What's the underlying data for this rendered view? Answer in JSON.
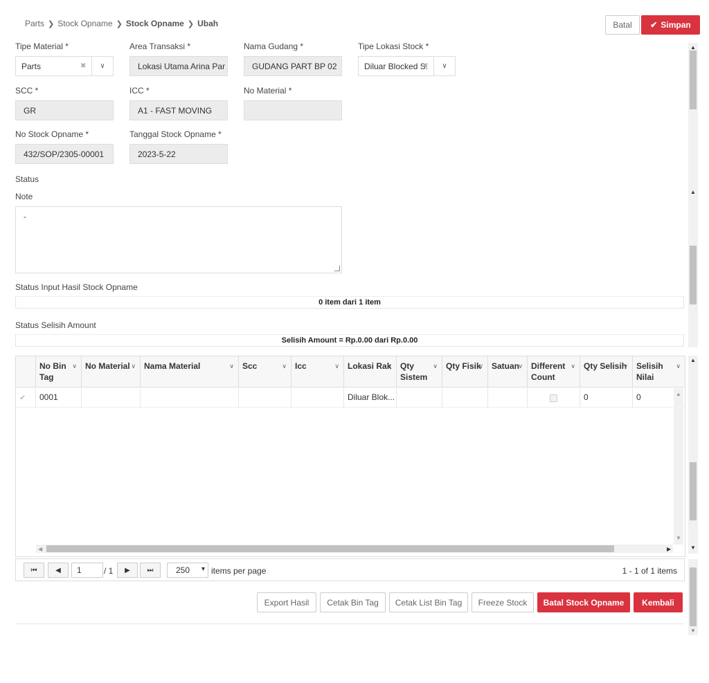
{
  "breadcrumb": {
    "items": [
      "Parts",
      "Stock Opname",
      "Stock Opname",
      "Ubah"
    ]
  },
  "header": {
    "cancel_label": "Batal",
    "save_label": "Simpan"
  },
  "form": {
    "tipe_material": {
      "label": "Tipe Material *",
      "value": "Parts"
    },
    "area_transaksi": {
      "label": "Area Transaksi *",
      "value": "Lokasi Utama Arina Par"
    },
    "nama_gudang": {
      "label": "Nama Gudang *",
      "value": "GUDANG PART BP 02"
    },
    "tipe_lokasi_stock": {
      "label": "Tipe Lokasi Stock *",
      "value": "Diluar Blocked S."
    },
    "scc": {
      "label": "SCC *",
      "value": "GR"
    },
    "icc": {
      "label": "ICC *",
      "value": "A1 - FAST MOVING"
    },
    "no_material": {
      "label": "No Material *",
      "value": ""
    },
    "no_stock_opname": {
      "label": "No Stock Opname *",
      "value": "432/SOP/2305-00001"
    },
    "tanggal_stock_opname": {
      "label": "Tanggal Stock Opname *",
      "value": "2023-5-22"
    },
    "status": {
      "label": "Status"
    },
    "note": {
      "label": "Note",
      "value": "-"
    }
  },
  "status_input": {
    "label": "Status Input Hasil Stock Opname",
    "summary": "0 item dari 1 item"
  },
  "status_selisih": {
    "label": "Status Selisih Amount",
    "summary": "Selisih Amount = Rp.0.00 dari Rp.0.00"
  },
  "grid": {
    "columns": [
      {
        "label": "",
        "w": 29
      },
      {
        "label": "No Bin Tag",
        "w": 66
      },
      {
        "label": "No Material",
        "w": 85
      },
      {
        "label": "Nama Material",
        "w": 142
      },
      {
        "label": "Scc",
        "w": 76
      },
      {
        "label": "Icc",
        "w": 76
      },
      {
        "label": "Lokasi Rak",
        "w": 76
      },
      {
        "label": "Qty Sistem",
        "w": 66
      },
      {
        "label": "Qty Fisik",
        "w": 66
      },
      {
        "label": "Satuan",
        "w": 57
      },
      {
        "label": "Different Count",
        "w": 76
      },
      {
        "label": "Qty Selisih",
        "w": 76
      },
      {
        "label": "Selisih Nilai",
        "w": 76
      }
    ],
    "rows": [
      {
        "no_bin_tag": "0001",
        "no_material": "",
        "nama_material": "",
        "scc": "",
        "icc": "",
        "lokasi_rak": "Diluar Blok...",
        "qty_sistem": "",
        "qty_fisik": "",
        "satuan": "",
        "qty_selisih": "0",
        "selisih_nilai": "0"
      }
    ]
  },
  "pager": {
    "page": "1",
    "of_pages": "/ 1",
    "page_size": "250",
    "per_page_label": "items per page",
    "range": "1 - 1 of 1 items"
  },
  "actions": {
    "export": "Export Hasil",
    "cetak_bin_tag": "Cetak Bin Tag",
    "cetak_list_bin_tag": "Cetak List Bin Tag",
    "freeze": "Freeze Stock",
    "batal_so": "Batal Stock Opname",
    "kembali": "Kembali"
  },
  "colors": {
    "accent": "#d9333f"
  }
}
